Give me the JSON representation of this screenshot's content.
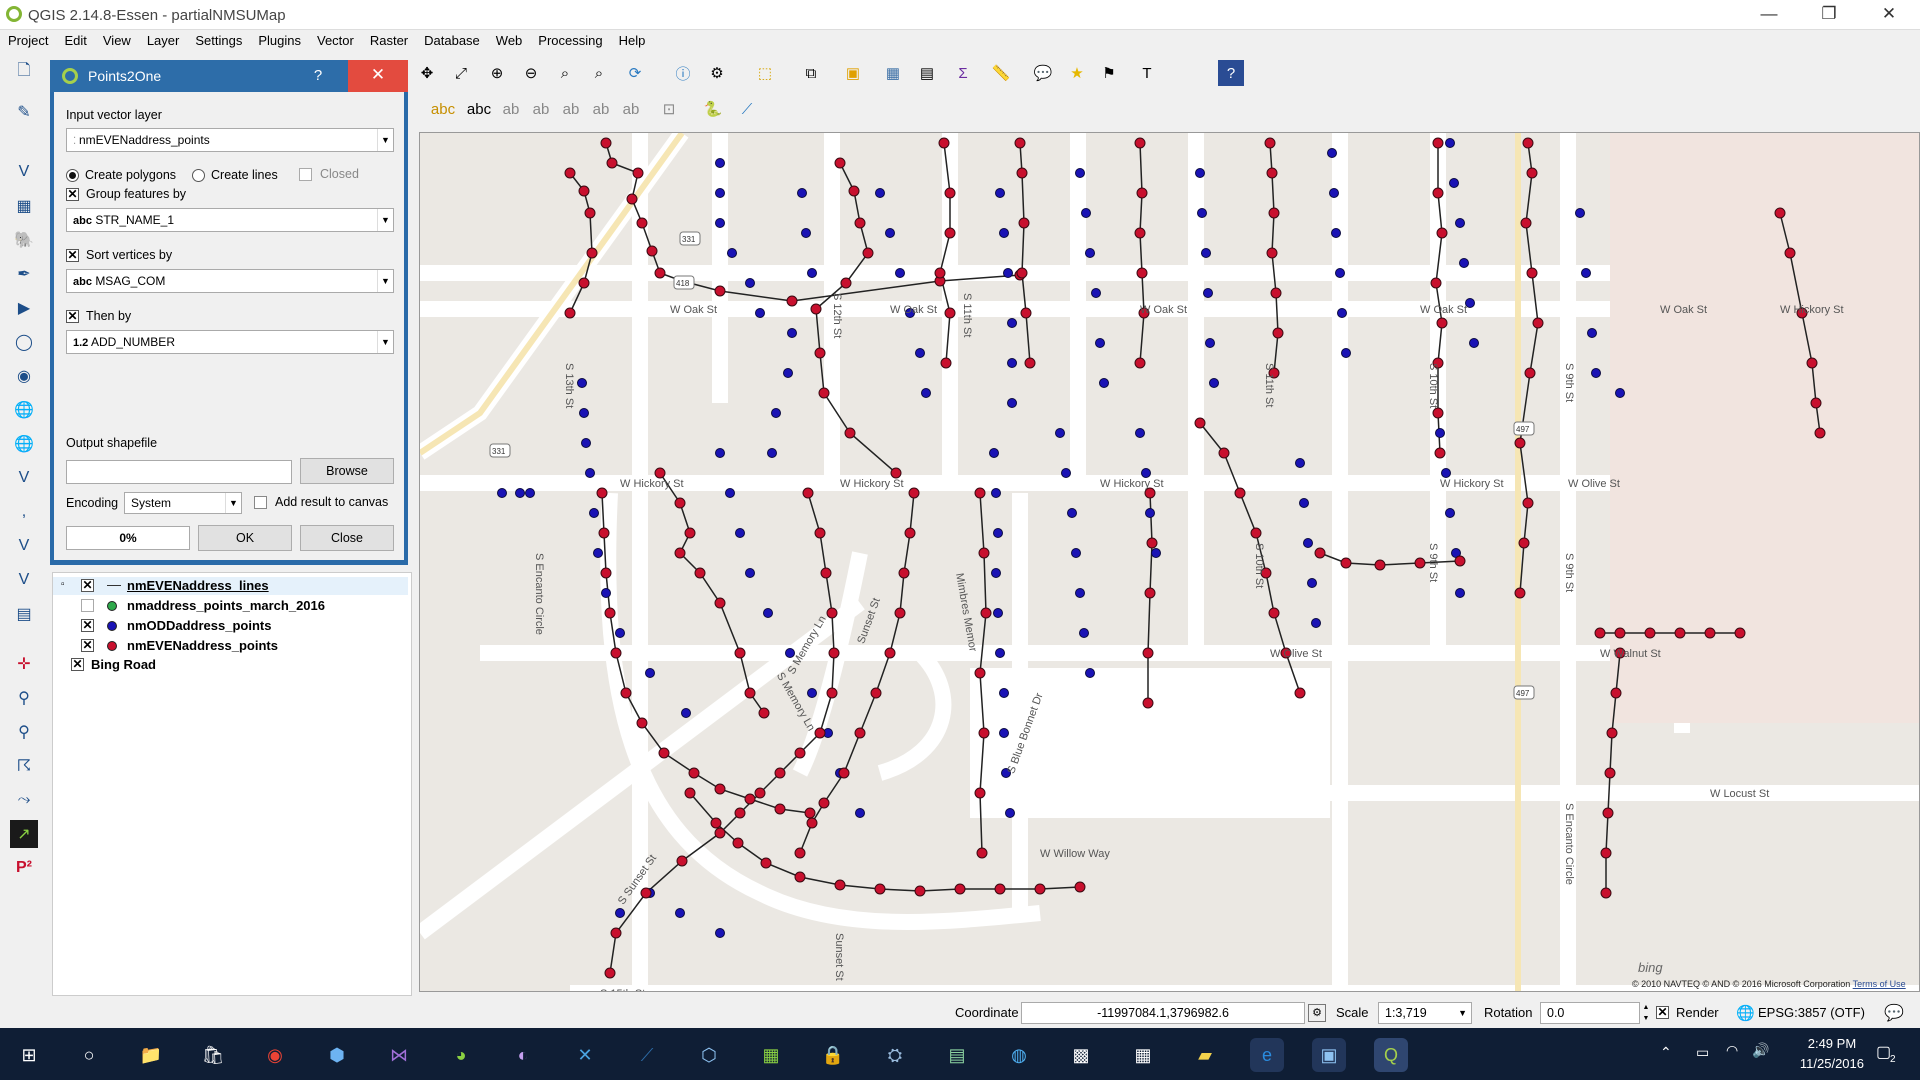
{
  "window": {
    "title": "QGIS 2.14.8-Essen - partialNMSUMap",
    "minimize": "—",
    "restore": "❐",
    "close": "✕"
  },
  "menu": [
    "Project",
    "Edit",
    "View",
    "Layer",
    "Settings",
    "Plugins",
    "Vector",
    "Raster",
    "Database",
    "Web",
    "Processing",
    "Help"
  ],
  "dialog": {
    "title": "Points2One",
    "help": "?",
    "close": "✕",
    "input_label": "Input vector layer",
    "input_value": "nmEVENaddress_points",
    "create_polygons": "Create polygons",
    "create_lines": "Create lines",
    "closed": "Closed",
    "group_label": "Group features by",
    "group_value_prefix": "abc",
    "group_value": "STR_NAME_1",
    "sort_label": "Sort vertices by",
    "sort_value_prefix": "abc",
    "sort_value": "MSAG_COM",
    "then_label": "Then by",
    "then_value_prefix": "1.2",
    "then_value": "ADD_NUMBER",
    "output_label": "Output shapefile",
    "output_value": "",
    "browse": "Browse",
    "encoding_label": "Encoding",
    "encoding_value": "System",
    "add_result": "Add result to canvas",
    "progress": "0%",
    "progress_value": 0,
    "ok": "OK",
    "close_btn": "Close"
  },
  "layers": [
    {
      "name": "nmEVENaddress_lines",
      "checked": true,
      "symbol": "line",
      "color": "#333333"
    },
    {
      "name": "nmaddress_points_march_2016",
      "checked": false,
      "symbol": "point",
      "color": "#2ea84a"
    },
    {
      "name": "nmODDaddress_points",
      "checked": true,
      "symbol": "point",
      "color": "#1a13b5"
    },
    {
      "name": "nmEVENaddress_points",
      "checked": true,
      "symbol": "point",
      "color": "#c8102e"
    },
    {
      "name": "Bing Road",
      "checked": true,
      "symbol": "none",
      "color": ""
    }
  ],
  "map": {
    "street_labels": [
      "W Ash St",
      "W Oak St",
      "W Oak St",
      "W Oak St",
      "W Oak St",
      "W Oak St",
      "W Hickory St",
      "W Hickory St",
      "W Hickory St",
      "W Hickory St",
      "W Hickory St",
      "W Olive St",
      "W Olive St",
      "W Walnut St",
      "W Locust St",
      "S 15th St",
      "S 13th St",
      "S 12th St",
      "S 11th St",
      "S 11th St",
      "S 10th St",
      "S 10th St",
      "S 9th St",
      "S 9th St",
      "S 9th St",
      "S Encanto Circle",
      "S Encanto Circle",
      "W Willow Way",
      "S Memory Ln",
      "S Memory Ln",
      "S Sunset St",
      "Sunset St",
      "Sunset St",
      "S Blue Bonnet Dr",
      "Mimbres Memor"
    ],
    "shields": [
      "331",
      "331",
      "418",
      "497",
      "497"
    ],
    "bing_logo": "bing",
    "copyright": "© 2010 NAVTEQ © AND © 2016 Microsoft Corporation",
    "terms": "Terms of Use"
  },
  "status": {
    "coordinate_label": "Coordinate",
    "coordinate_value": "-11997084.1,3796982.6",
    "scale_label": "Scale",
    "scale_value": "1:3,719",
    "rotation_label": "Rotation",
    "rotation_value": "0.0",
    "render_label": "Render",
    "crs": "EPSG:3857 (OTF)"
  },
  "taskbar": {
    "time": "2:49 PM",
    "date": "11/25/2016",
    "notifications": "2"
  },
  "colors": {
    "even_points": "#c8102e",
    "odd_points": "#1a13b5",
    "dialog_blue": "#2d6da9",
    "close_red": "#e34b3f",
    "taskbar": "#0f1e35"
  }
}
